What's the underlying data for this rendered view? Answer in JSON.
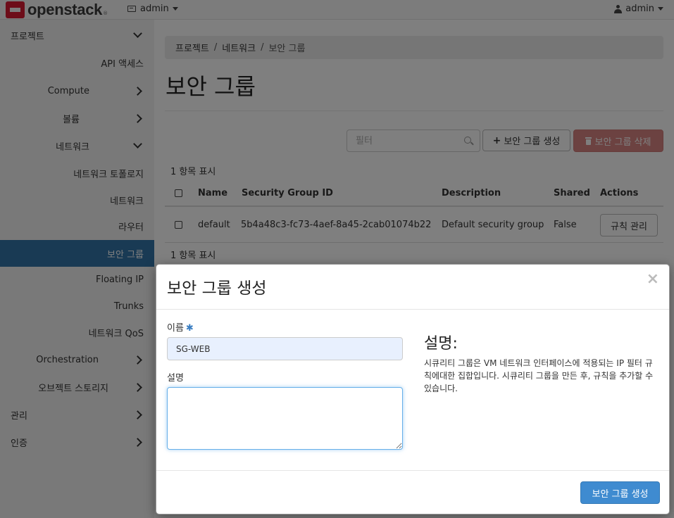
{
  "topbar": {
    "logo_text": "openstack",
    "logo_reg": "®",
    "project_label": "admin",
    "user_label": "admin"
  },
  "sidebar": {
    "items": [
      {
        "label": "프로젝트",
        "chevron": "down"
      },
      {
        "label": "API 액세스"
      },
      {
        "label": "Compute",
        "chevron": "right"
      },
      {
        "label": "볼륨",
        "chevron": "right"
      },
      {
        "label": "네트워크",
        "chevron": "down"
      },
      {
        "label": "네트워크 토폴로지"
      },
      {
        "label": "네트워크"
      },
      {
        "label": "라우터"
      },
      {
        "label": "보안 그룹",
        "active": true
      },
      {
        "label": "Floating IP"
      },
      {
        "label": "Trunks"
      },
      {
        "label": "네트워크 QoS"
      },
      {
        "label": "Orchestration",
        "chevron": "right"
      },
      {
        "label": "오브젝트 스토리지",
        "chevron": "right"
      },
      {
        "label": "관리",
        "chevron": "right"
      },
      {
        "label": "인증",
        "chevron": "right"
      }
    ]
  },
  "breadcrumb": {
    "items": [
      "프로젝트",
      "네트워크",
      "보안 그룹"
    ],
    "separator": "/"
  },
  "page": {
    "title": "보안 그룹",
    "filter_placeholder": "필터",
    "create_button": "보안 그룹 생성",
    "delete_button": "보안 그룹 삭제",
    "count_text_top": "1 항목 표시",
    "count_text_bottom": "1 항목 표시"
  },
  "table": {
    "columns": [
      "Name",
      "Security Group ID",
      "Description",
      "Shared",
      "Actions"
    ],
    "rows": [
      {
        "name": "default",
        "id": "5b4a48c3-fc73-4aef-8a45-2cab01074b22",
        "description": "Default security group",
        "shared": "False",
        "action": "규칙 관리"
      }
    ]
  },
  "modal": {
    "title": "보안 그룹 생성",
    "close": "×",
    "name_label": "이름",
    "required_mark": "✱",
    "name_value": "SG-WEB",
    "desc_label": "설명",
    "desc_value": "",
    "help_title": "설명:",
    "help_text": "시큐리티 그룹은 VM 네트워크 인터페이스에 적용되는 IP 필터 규칙에대한 집합입니다. 시큐리티 그룹을 만든 후, 규칙을 추가할 수 있습니다.",
    "submit": "보안 그룹 생성"
  },
  "colors": {
    "sidebar_active": "#3374a9",
    "primary": "#3f8bd0",
    "danger": "#d9534f",
    "logo_red": "#da1a32"
  }
}
